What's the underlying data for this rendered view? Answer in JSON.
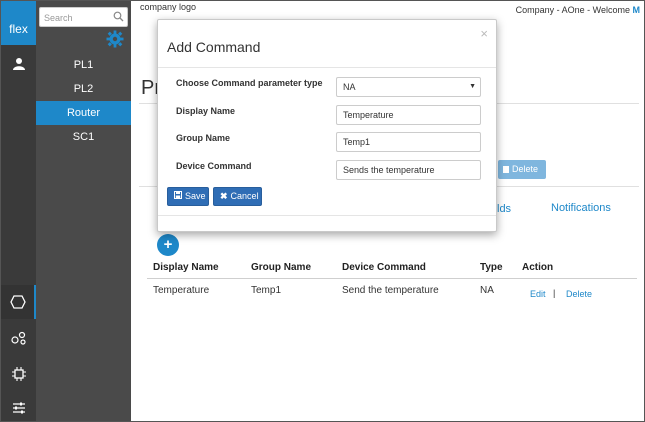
{
  "rail": {
    "logo": "flex",
    "items": [
      "user-icon",
      "hexagon-icon",
      "nodes-icon",
      "chip-icon",
      "sliders-icon"
    ]
  },
  "sidebar": {
    "search_placeholder": "Search",
    "items": [
      {
        "label": "PL1"
      },
      {
        "label": "PL2"
      },
      {
        "label": "Router"
      },
      {
        "label": "SC1"
      }
    ],
    "active_item": "Router"
  },
  "header": {
    "company_logo": "company logo",
    "welcome_prefix": "Company - AOne - Welcome",
    "welcome_user": "M"
  },
  "page": {
    "title_fragment": "Pr",
    "delete_label": "Delete",
    "tabs": {
      "partial": "lds",
      "notifications": "Notifications"
    },
    "add_label": "+"
  },
  "table": {
    "columns": [
      "Display Name",
      "Group Name",
      "Device Command",
      "Type",
      "Action"
    ],
    "rows": [
      {
        "display_name": "Temperature",
        "group_name": "Temp1",
        "device_command": "Send the temperature",
        "type": "NA",
        "edit": "Edit",
        "separator": "|",
        "delete": "Delete"
      }
    ]
  },
  "modal": {
    "title": "Add Command",
    "close": "×",
    "fields": {
      "param_type_label": "Choose Command parameter type",
      "param_type_value": "NA",
      "display_name_label": "Display Name",
      "display_name_value": "Temperature",
      "group_name_label": "Group Name",
      "group_name_value": "Temp1",
      "device_command_label": "Device Command",
      "device_command_value": "Sends the temperature"
    },
    "save_label": "Save",
    "cancel_label": "Cancel"
  },
  "colors": {
    "accent": "#1e88c9",
    "rail": "#3a3a3a",
    "panel": "#4a4a4a",
    "button": "#2f6db5"
  }
}
